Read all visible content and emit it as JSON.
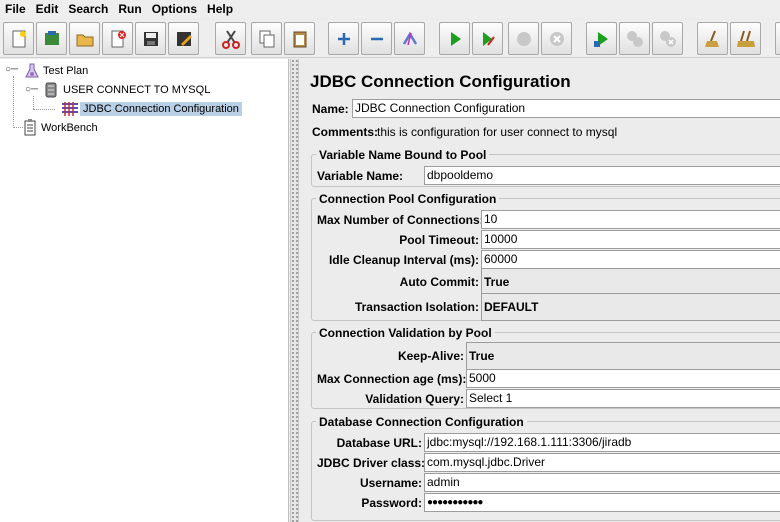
{
  "menu": {
    "file": "File",
    "edit": "Edit",
    "search": "Search",
    "run": "Run",
    "options": "Options",
    "help": "Help"
  },
  "toolbar": {
    "icons": [
      "new-icon",
      "templates-icon",
      "open-icon",
      "close-icon",
      "save-icon",
      "save-as-icon",
      "cut-icon",
      "copy-icon",
      "paste-icon",
      "expand-icon",
      "collapse-icon",
      "toggle-icon",
      "start-icon",
      "start-no-pause-icon",
      "stop-icon",
      "shutdown-icon",
      "remote-start-icon",
      "remote-stop-icon",
      "remote-shutdown-icon",
      "clear-icon",
      "clear-all-icon"
    ]
  },
  "tree": {
    "test_plan": "Test Plan",
    "thread_group": "USER CONNECT TO MYSQL",
    "jdbc_config": "JDBC Connection Configuration",
    "workbench": "WorkBench"
  },
  "form": {
    "title": "JDBC Connection Configuration",
    "name_label": "Name:",
    "name_value": "JDBC Connection Configuration",
    "comments_label": "Comments:",
    "comments_value": "this is configuration for user connect to mysql",
    "var_group_title": "Variable Name Bound to Pool",
    "var_name_label": "Variable Name:",
    "var_name_value": "dbpooldemo",
    "pool_group_title": "Connection Pool Configuration",
    "max_conn_label": "Max Number of Connections:",
    "max_conn_value": "10",
    "pool_timeout_label": "Pool Timeout:",
    "pool_timeout_value": "10000",
    "idle_cleanup_label": "Idle Cleanup Interval (ms):",
    "idle_cleanup_value": "60000",
    "auto_commit_label": "Auto Commit:",
    "auto_commit_value": "True",
    "tx_isolation_label": "Transaction Isolation:",
    "tx_isolation_value": "DEFAULT",
    "validation_group_title": "Connection Validation by Pool",
    "keep_alive_label": "Keep-Alive:",
    "keep_alive_value": "True",
    "max_age_label": "Max Connection age (ms):",
    "max_age_value": "5000",
    "validation_query_label": "Validation Query:",
    "validation_query_value": "Select 1",
    "db_group_title": "Database Connection Configuration",
    "db_url_label": "Database URL:",
    "db_url_value": "jdbc:mysql://192.168.1.111:3306/jiradb",
    "driver_label": "JDBC Driver class:",
    "driver_value": "com.mysql.jdbc.Driver",
    "username_label": "Username:",
    "username_value": "admin",
    "password_label": "Password:",
    "password_value": "●●●●●●●●●●●"
  }
}
